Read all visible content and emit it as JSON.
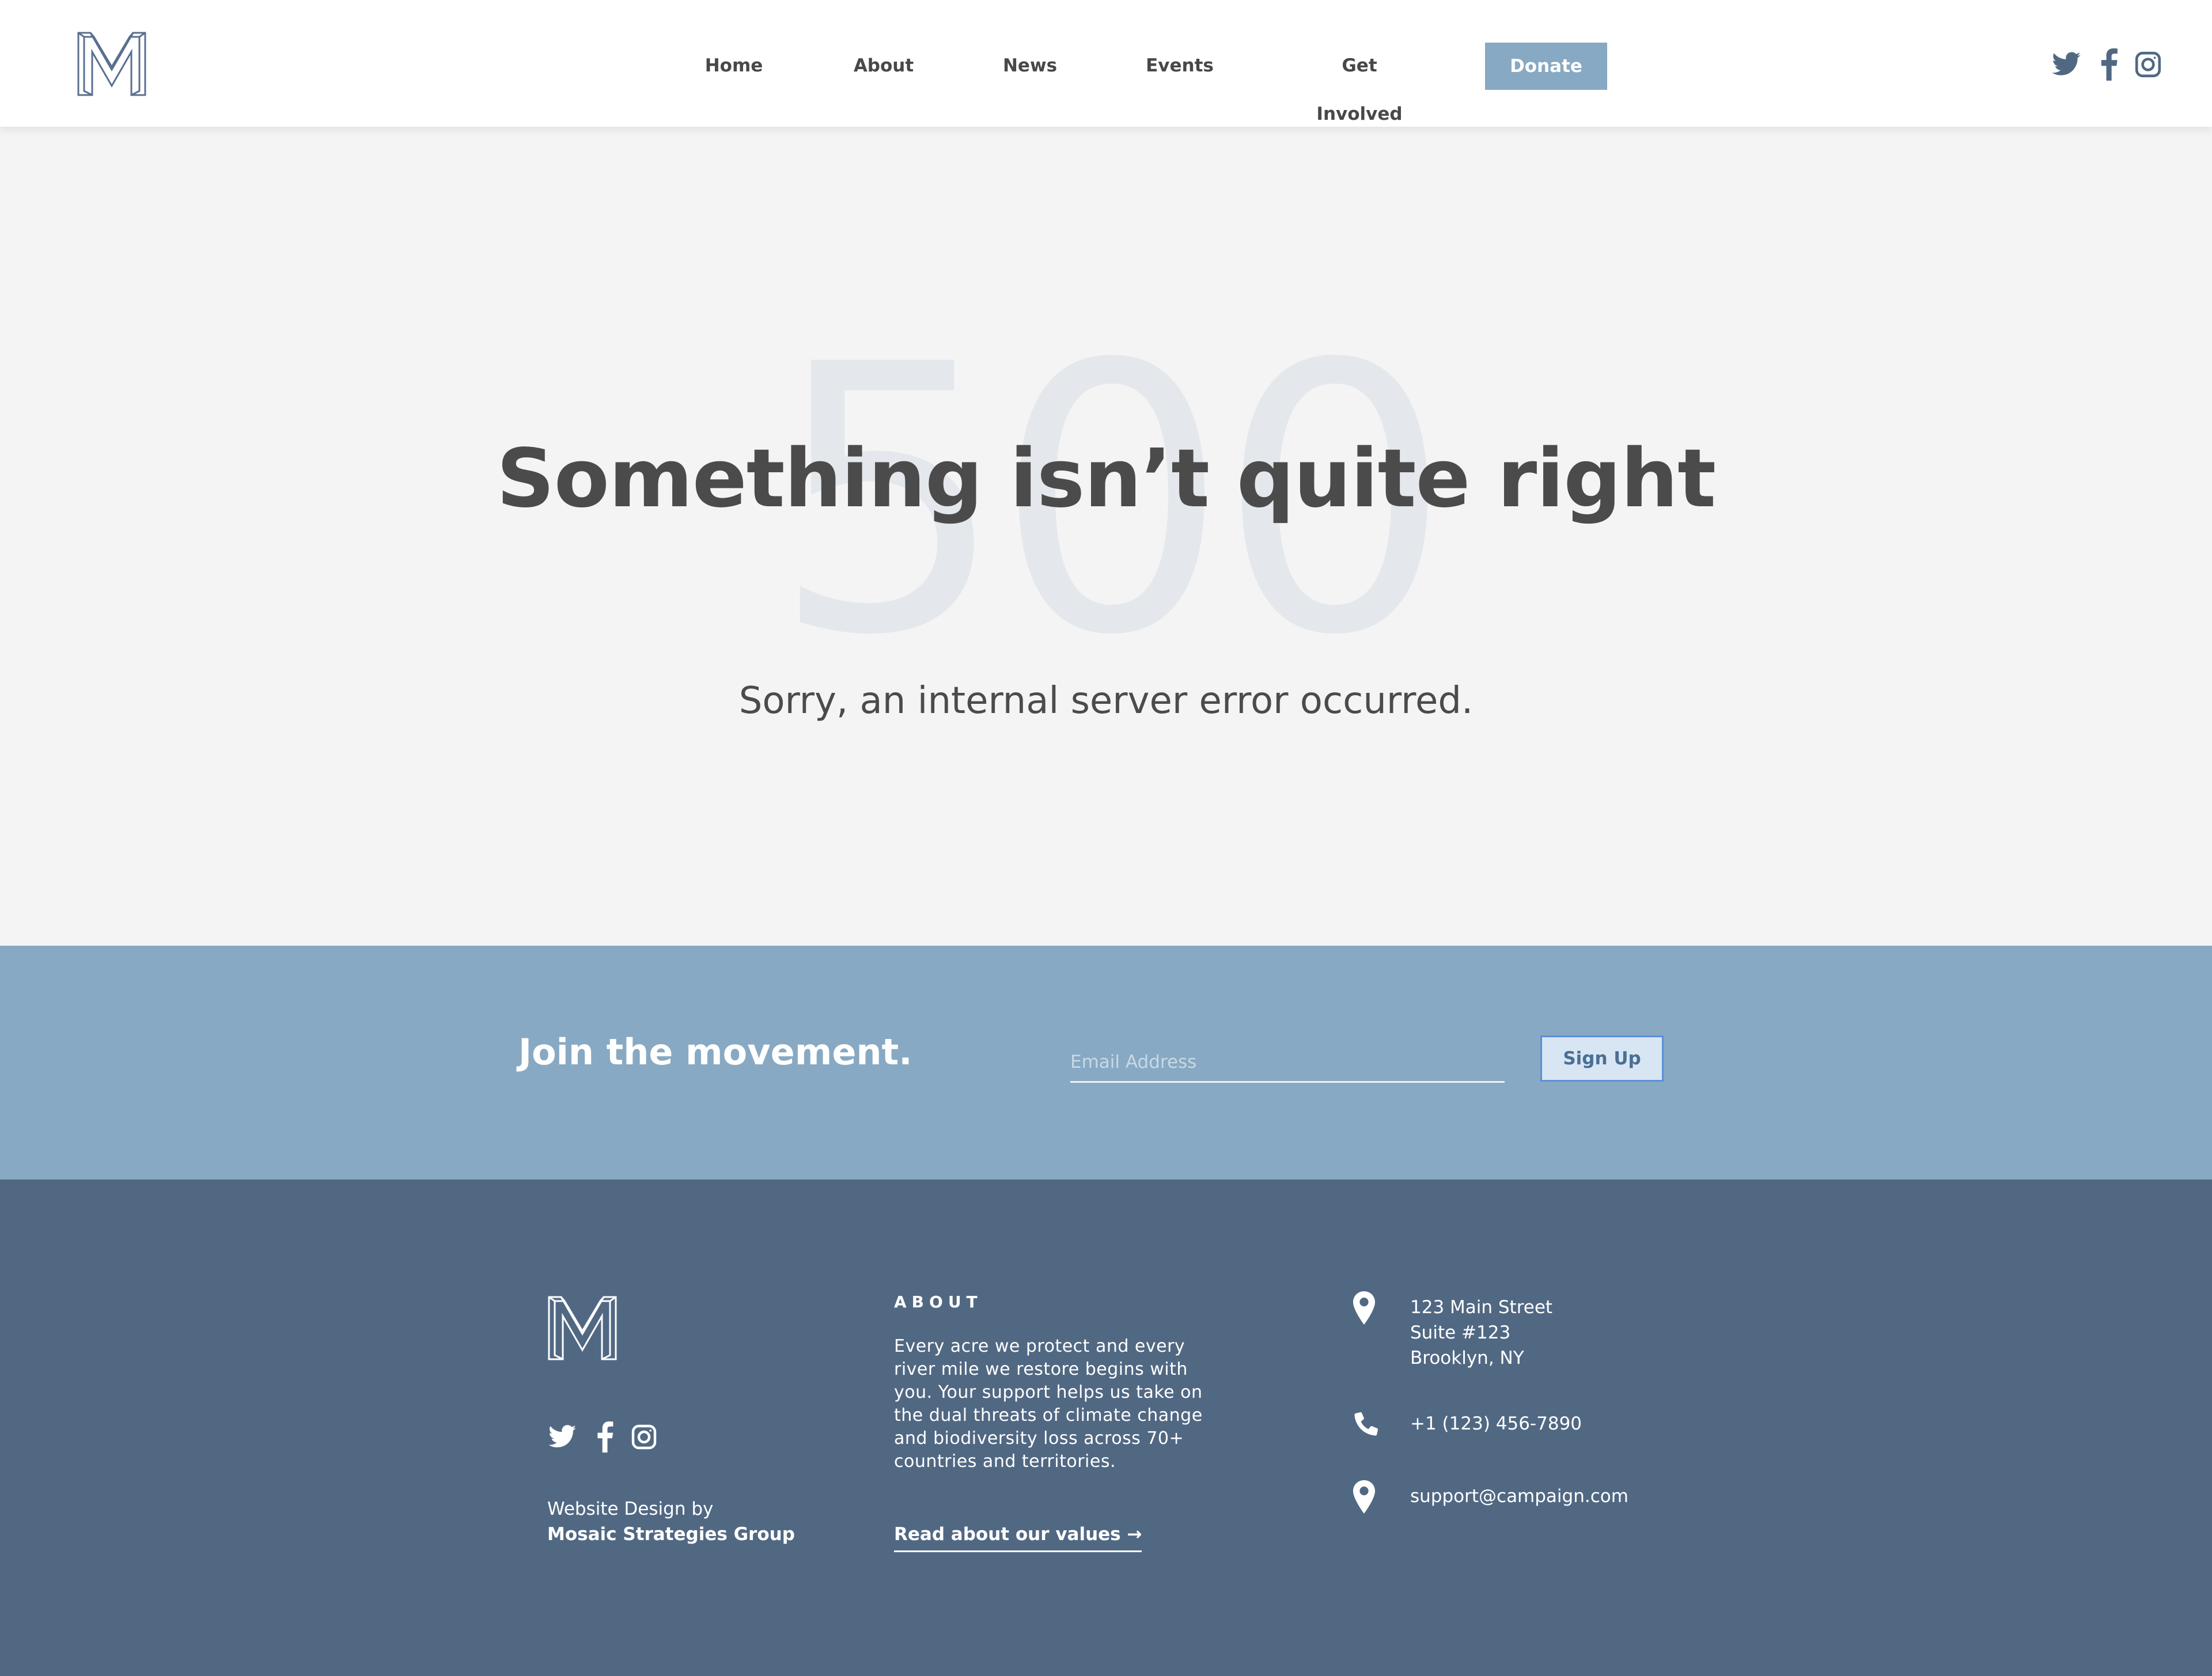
{
  "header": {
    "logo_icon": "m-monogram-logo",
    "nav": [
      {
        "label": "Home"
      },
      {
        "label": "About"
      },
      {
        "label": "News"
      },
      {
        "label": "Events"
      },
      {
        "label": "Get Involved"
      }
    ],
    "donate_label": "Donate",
    "social_icons": [
      "twitter-icon",
      "facebook-icon",
      "instagram-icon"
    ]
  },
  "hero": {
    "code": "500",
    "title": "Something isn’t quite right",
    "subtitle": "Sorry, an internal server error occurred."
  },
  "newsletter": {
    "heading": "Join the movement.",
    "email_placeholder": "Email Address",
    "signup_label": "Sign Up"
  },
  "footer": {
    "design_by_label": "Website Design by",
    "design_by_firm": "Mosaic Strategies Group",
    "about_heading": "ABOUT",
    "about_text": "Every acre we protect and every river mile we restore begins with you. Your support helps us take on the dual threats of climate change and biodiversity loss across 70+ countries and territories.",
    "values_link": "Read about our values →",
    "address_lines": [
      "123 Main Street",
      "Suite #123",
      "Brooklyn, NY"
    ],
    "phone": "+1 (123) 456-7890",
    "email": "support@campaign.com"
  },
  "colors": {
    "accent": "#87a9c3",
    "footer_bg": "#516883",
    "hero_bg": "#f4f4f4",
    "heading_text": "#4b4b4b",
    "big_code": "#e4e8ec"
  }
}
